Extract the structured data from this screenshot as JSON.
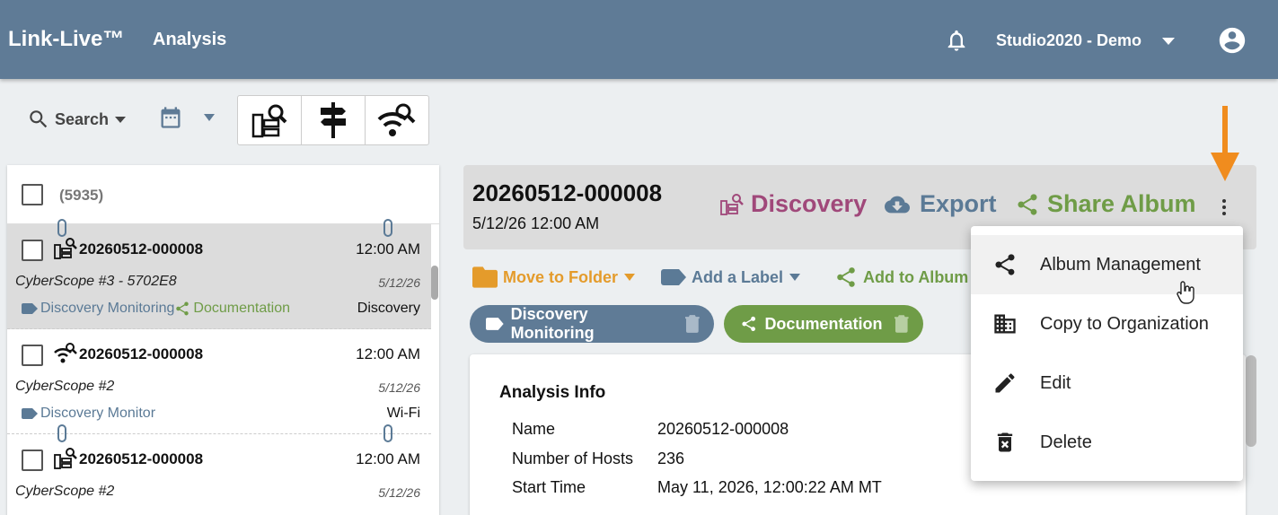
{
  "header": {
    "brand": "Link-Live™",
    "nav_title": "Analysis",
    "org_name": "Studio2020 - Demo"
  },
  "toolbar": {
    "search_label": "Search",
    "icons": [
      "discovery-search-icon",
      "signpost-icon",
      "wifi-search-icon"
    ]
  },
  "list": {
    "count": "(5935)",
    "rows": [
      {
        "id": "20260512-000008",
        "time": "12:00 AM",
        "device": "CyberScope #3 - 5702E8",
        "date": "5/12/26",
        "tags": [
          "Discovery Monitoring",
          "Documentation"
        ],
        "type": "Discovery",
        "icon": "discovery-icon"
      },
      {
        "id": "20260512-000008",
        "time": "12:00 AM",
        "device": "CyberScope #2",
        "date": "5/12/26",
        "tags": [
          "Discovery Monitor"
        ],
        "type": "Wi-Fi",
        "icon": "wifi-search-icon"
      },
      {
        "id": "20260512-000008",
        "time": "12:00 AM",
        "device": "CyberScope #2",
        "date": "5/12/26",
        "icon": "discovery-icon"
      }
    ]
  },
  "detail": {
    "id": "20260512-000008",
    "datetime": "5/12/26 12:00 AM",
    "discovery_label": "Discovery",
    "export_label": "Export",
    "share_album_label": "Share Album",
    "move_to_folder_label": "Move to Folder",
    "add_label_label": "Add a Label",
    "add_to_album_label": "Add to Album",
    "chips": [
      "Discovery Monitoring",
      "Documentation"
    ],
    "info": {
      "title": "Analysis Info",
      "fields": [
        {
          "label": "Name",
          "value": "20260512-000008"
        },
        {
          "label": "Number of Hosts",
          "value": "236"
        },
        {
          "label": "Start Time",
          "value": "May 11, 2026, 12:00:22 AM MT"
        }
      ]
    }
  },
  "menu": {
    "items": [
      {
        "label": "Album Management",
        "icon": "share-icon"
      },
      {
        "label": "Copy to Organization",
        "icon": "building-icon"
      },
      {
        "label": "Edit",
        "icon": "pencil-icon"
      },
      {
        "label": "Delete",
        "icon": "trash-icon"
      }
    ]
  },
  "colors": {
    "appbar": "#5f7b96",
    "discovery": "#a0487a",
    "export": "#5b7a96",
    "share": "#6f9c47",
    "folder": "#e49b2b",
    "arrow": "#f08c1e"
  }
}
